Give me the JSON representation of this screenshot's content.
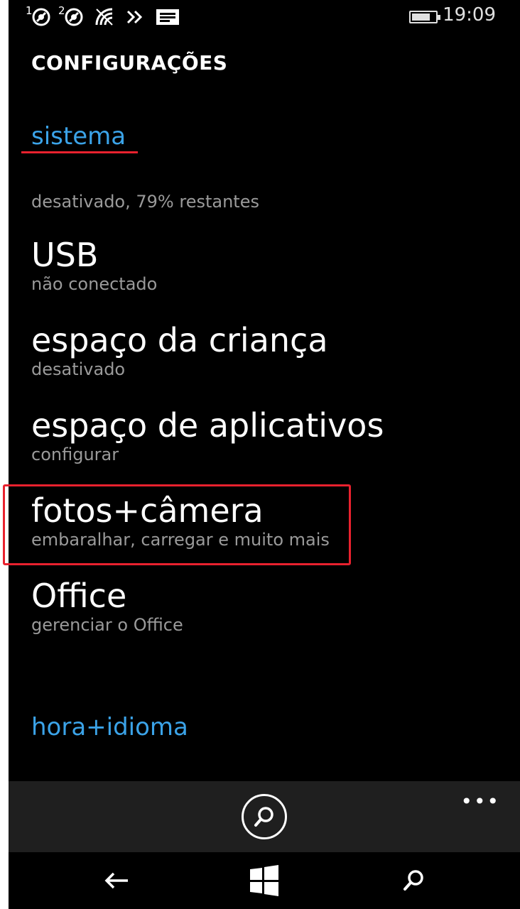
{
  "status_bar": {
    "sim1_number": "1",
    "sim2_number": "2",
    "time": "19:09",
    "battery_level": 0.79,
    "icons": [
      "sim1-signal-icon",
      "sim2-signal-icon",
      "wifi-icon",
      "data-sense-icon",
      "notification-icon",
      "battery-icon"
    ]
  },
  "page": {
    "title": "CONFIGURAÇÕES"
  },
  "sections": {
    "current": "sistema",
    "next": "hora+idioma"
  },
  "battery_saver_status": "desativado, 79% restantes",
  "items": [
    {
      "title": "USB",
      "subtitle": "não conectado"
    },
    {
      "title": "espaço da criança",
      "subtitle": "desativado"
    },
    {
      "title": "espaço de aplicativos",
      "subtitle": "configurar"
    },
    {
      "title": "fotos+câmera",
      "subtitle": "embaralhar, carregar e muito mais"
    },
    {
      "title": "Office",
      "subtitle": "gerenciar o Office"
    }
  ],
  "app_bar": {
    "ellipsis": "•••",
    "buttons": [
      "search-icon"
    ]
  },
  "nav_bar": {
    "buttons": [
      "back-arrow-icon",
      "windows-logo-icon",
      "search-icon"
    ]
  },
  "colors": {
    "accent": "#3ba3e8",
    "annotation": "#e8212e",
    "background": "#000000",
    "app_bar": "#1f1f1f",
    "subtle_text": "#9a9a9a"
  }
}
